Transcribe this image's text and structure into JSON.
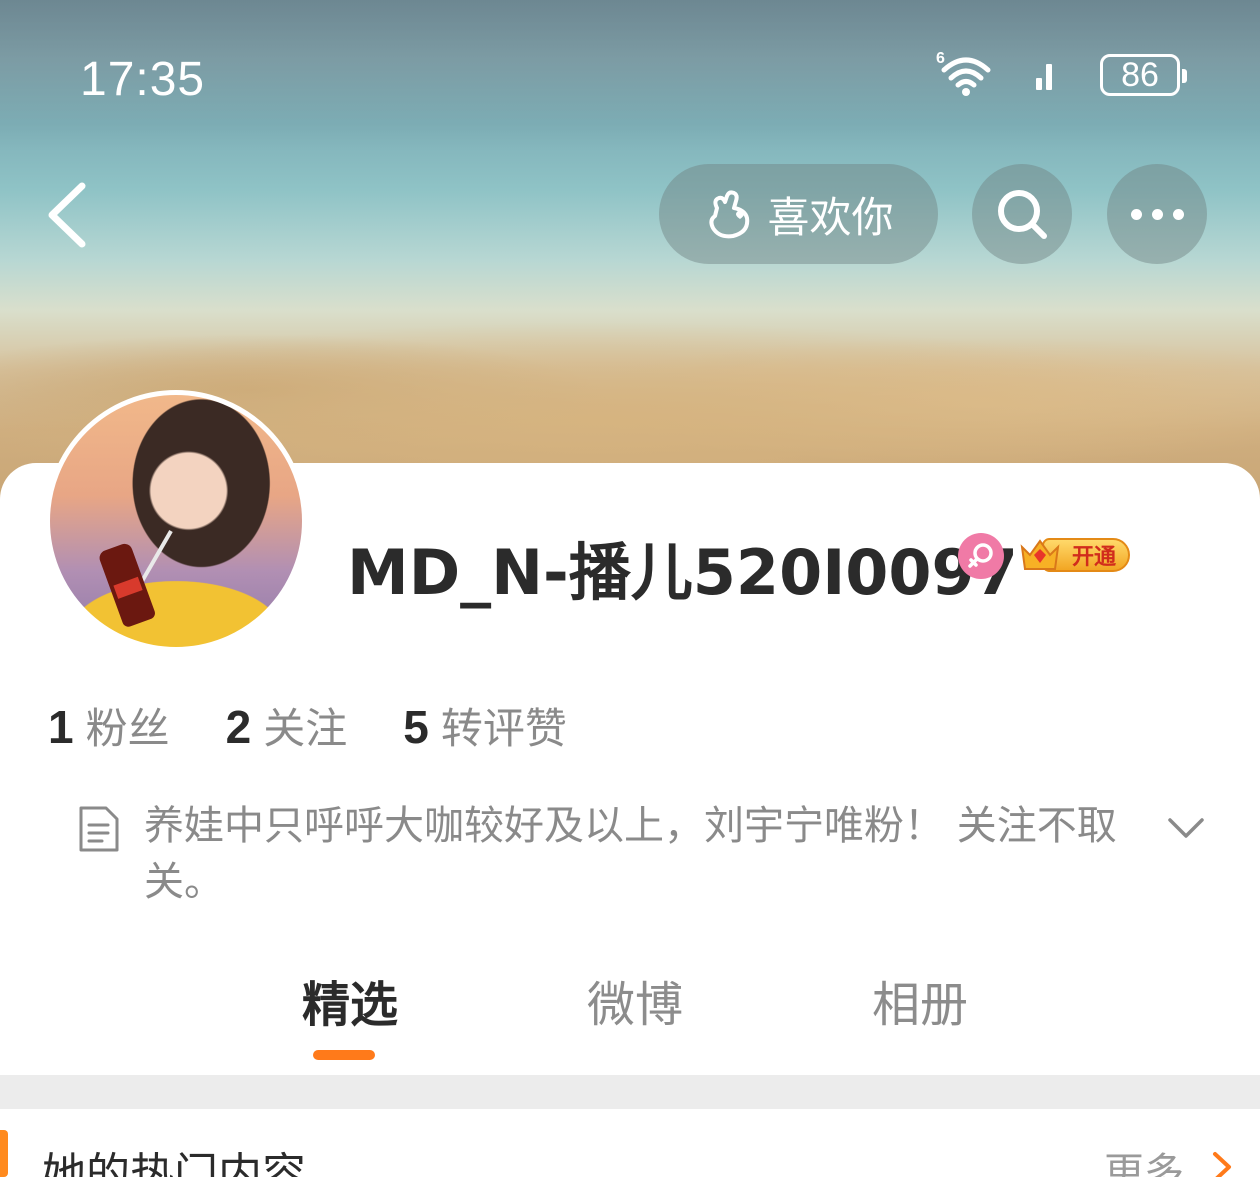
{
  "status_bar": {
    "time": "17:35",
    "network": "6",
    "battery": "86"
  },
  "header": {
    "like_button_label": "喜欢你",
    "icons": [
      "back-icon",
      "hand-heart-icon",
      "search-icon",
      "more-icon"
    ]
  },
  "profile": {
    "username": "MD_N-播儿520I0097",
    "gender": "female",
    "vip_label": "开通"
  },
  "stats": [
    {
      "value": "1",
      "label": "粉丝"
    },
    {
      "value": "2",
      "label": "关注"
    },
    {
      "value": "5",
      "label": "转评赞"
    }
  ],
  "bio": {
    "text": "养娃中只呼呼大咖较好及以上，刘宇宁唯粉！ 关注不取关。"
  },
  "tabs": [
    {
      "label": "精选",
      "active": true
    },
    {
      "label": "微博",
      "active": false
    },
    {
      "label": "相册",
      "active": false
    }
  ],
  "section": {
    "title": "她的热门内容",
    "more": "更多"
  },
  "colors": {
    "accent": "#ff7a1a",
    "gender_badge": "#f07aa6",
    "text_primary": "#2b2b2b",
    "text_secondary": "#8a8a8a"
  }
}
